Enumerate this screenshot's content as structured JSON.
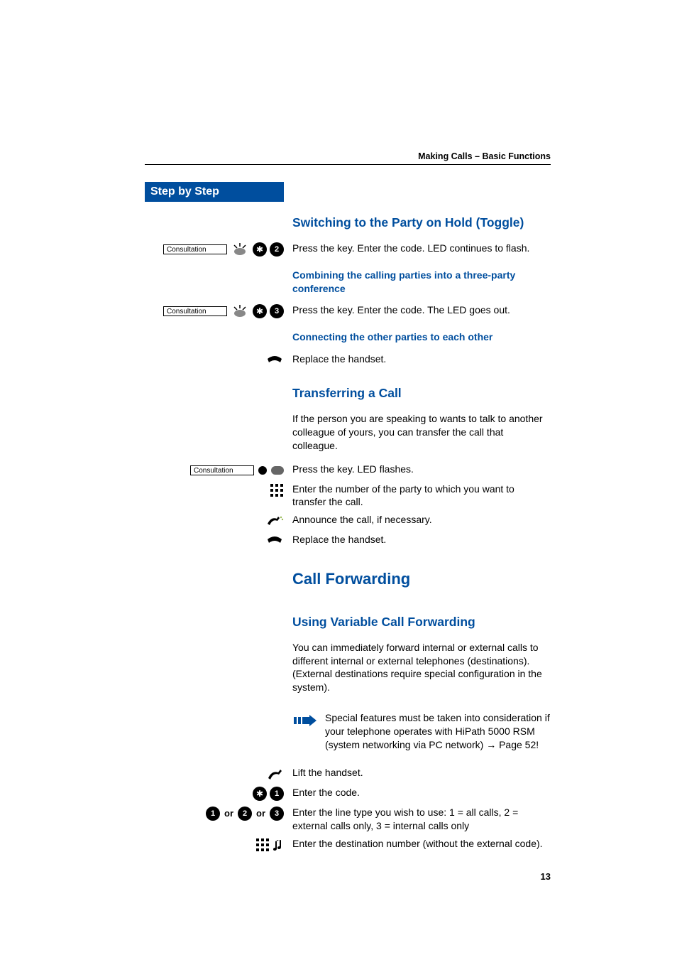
{
  "header": {
    "chapter": "Making Calls – Basic Functions"
  },
  "sidebar": {
    "title": "Step by Step"
  },
  "steps": {
    "switching_heading": "Switching to the Party on Hold (Toggle)",
    "switching_text": "Press the key. Enter the code. LED continues to flash.",
    "combining_heading": "Combining the calling parties into a three-party conference",
    "combining_text": "Press the key. Enter the code. The LED goes out.",
    "connecting_heading": "Connecting the other parties to each other",
    "connecting_text": "Replace the handset.",
    "transfer_heading": "Transferring a Call",
    "transfer_intro": "If the person you are speaking to wants to talk to another colleague of yours, you can transfer the call that colleague.",
    "transfer_press": "Press the key. LED flashes.",
    "transfer_enter_num": "Enter the number of the party to which you want to transfer the call.",
    "transfer_announce": "Announce the call, if necessary.",
    "transfer_replace": "Replace the handset.",
    "forwarding_h2": "Call Forwarding",
    "using_var_heading": "Using Variable Call Forwarding",
    "using_var_text": "You can immediately forward internal or external calls to different internal or external telephones (destinations). (External destinations require special configuration in the system).",
    "note_text": "Special features must be taken into consideration if your telephone operates with HiPath 5000 RSM (system networking via PC network)",
    "note_pageref": "Page 52!",
    "lift": "Lift the handset.",
    "enter_code": "Enter the code.",
    "enter_line_type": "Enter the line type you wish to use:  1 = all calls, 2 = external calls only, 3 = internal calls only",
    "enter_dest": "Enter the destination number (without the external code).",
    "key_label": "Consultation",
    "or": "or",
    "digits": {
      "d1": "1",
      "d2": "2",
      "d3": "3"
    },
    "page_number": "13"
  }
}
